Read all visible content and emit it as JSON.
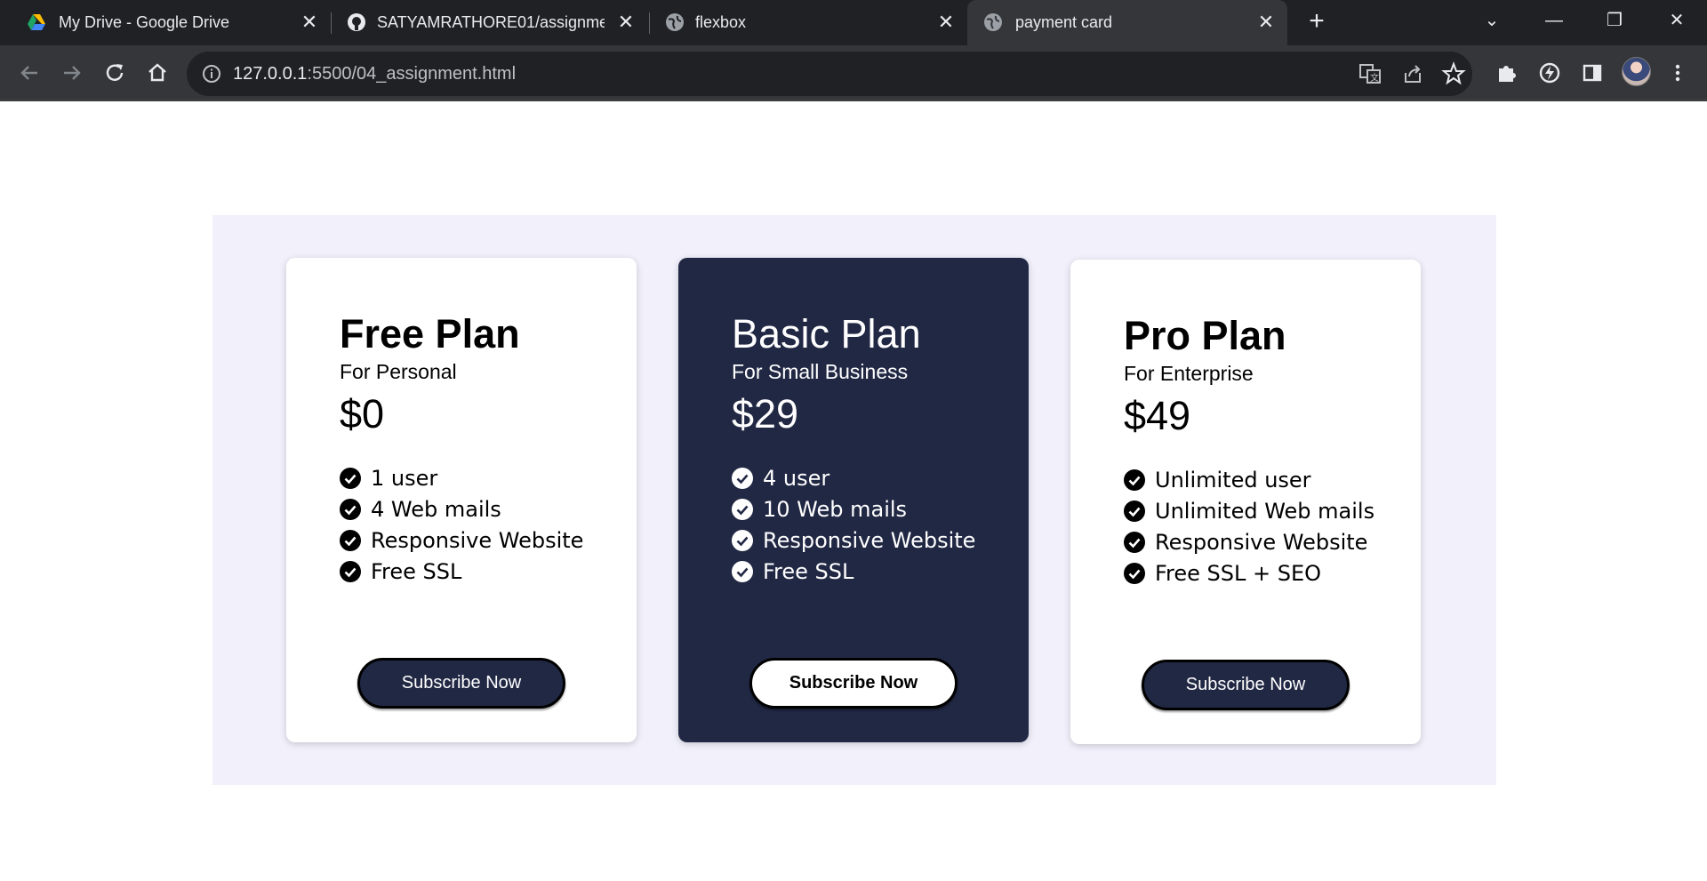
{
  "browser": {
    "tabs": [
      {
        "title": "My Drive - Google Drive",
        "icon": "google-drive-icon",
        "active": false
      },
      {
        "title": "SATYAMRATHORE01/assignment",
        "icon": "github-icon",
        "active": false
      },
      {
        "title": "flexbox",
        "icon": "globe-icon",
        "active": false
      },
      {
        "title": "payment card",
        "icon": "globe-icon",
        "active": true
      }
    ],
    "address": {
      "host": "127.0.0.1",
      "path": ":5500/04_assignment.html"
    }
  },
  "plans": [
    {
      "name": "Free Plan",
      "subtitle": "For Personal",
      "price": "$0",
      "features": [
        "1 user",
        "4 Web mails",
        "Responsive Website",
        "Free SSL"
      ],
      "button": "Subscribe Now",
      "theme": "light"
    },
    {
      "name": "Basic Plan",
      "subtitle": "For Small Business",
      "price": "$29",
      "features": [
        "4 user",
        "10 Web mails",
        "Responsive Website",
        "Free SSL"
      ],
      "button": "Subscribe Now",
      "theme": "dark"
    },
    {
      "name": "Pro Plan",
      "subtitle": "For Enterprise",
      "price": "$49",
      "features": [
        "Unlimited user",
        "Unlimited Web mails",
        "Responsive Website",
        "Free SSL + SEO"
      ],
      "button": "Subscribe Now",
      "theme": "light"
    }
  ],
  "colors": {
    "dark_card": "#212844",
    "panel_bg": "#f1f0fb",
    "chrome_dark": "#202124",
    "chrome_toolbar": "#35363a"
  }
}
